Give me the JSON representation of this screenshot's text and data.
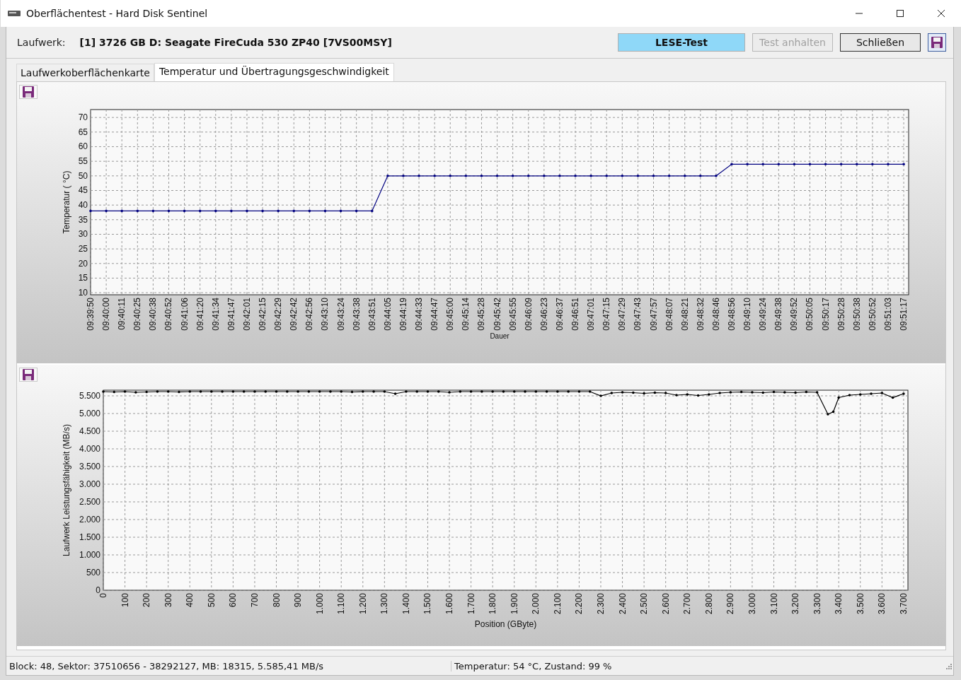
{
  "window": {
    "title": "Oberflächentest - Hard Disk Sentinel"
  },
  "toolbar": {
    "drive_label": "Laufwerk:",
    "drive_value": "[1] 3726 GB D: Seagate FireCuda 530 ZP40 [7VS00MSY]",
    "buttons": [
      {
        "label": "LESE-Test",
        "kind": "indicator",
        "disabled": false
      },
      {
        "label": "Test anhalten",
        "kind": "button",
        "disabled": true
      },
      {
        "label": "Schließen",
        "kind": "button",
        "disabled": false
      }
    ]
  },
  "tabs": [
    {
      "label": "Laufwerkoberflächenkarte",
      "selected": false
    },
    {
      "label": "Temperatur und Übertragungsgeschwindigkeit",
      "selected": true
    }
  ],
  "panels": [
    {
      "chart_data": {
        "type": "line",
        "xlabel": "Dauer",
        "ylabel": "Temperatur ( °C)",
        "categories": [
          "09:39:50",
          "09:40:00",
          "09:40:11",
          "09:40:25",
          "09:40:38",
          "09:40:52",
          "09:41:06",
          "09:41:20",
          "09:41:34",
          "09:41:47",
          "09:42:01",
          "09:42:15",
          "09:42:29",
          "09:42:42",
          "09:42:56",
          "09:43:10",
          "09:43:24",
          "09:43:38",
          "09:43:51",
          "09:44:05",
          "09:44:19",
          "09:44:33",
          "09:44:47",
          "09:45:00",
          "09:45:14",
          "09:45:28",
          "09:45:42",
          "09:45:55",
          "09:46:09",
          "09:46:23",
          "09:46:37",
          "09:46:51",
          "09:47:01",
          "09:47:15",
          "09:47:29",
          "09:47:43",
          "09:47:57",
          "09:48:07",
          "09:48:21",
          "09:48:32",
          "09:48:46",
          "09:48:56",
          "09:49:10",
          "09:49:24",
          "09:49:38",
          "09:49:52",
          "09:50:05",
          "09:50:17",
          "09:50:28",
          "09:50:38",
          "09:50:52",
          "09:51:03",
          "09:51:17"
        ],
        "grid": true,
        "series": [
          {
            "color": "#000080",
            "values": [
              38,
              38,
              38,
              38,
              38,
              38,
              38,
              38,
              38,
              38,
              38,
              38,
              38,
              38,
              38,
              38,
              38,
              38,
              38,
              50,
              50,
              50,
              50,
              50,
              50,
              50,
              50,
              50,
              50,
              50,
              50,
              50,
              50,
              50,
              50,
              50,
              50,
              50,
              50,
              50,
              50,
              54,
              54,
              54,
              54,
              54,
              54,
              54,
              54,
              54,
              54,
              54,
              54
            ]
          }
        ],
        "ylim": [
          9.3,
          72.7
        ],
        "yticks": [
          10,
          15,
          20,
          25,
          30,
          35,
          40,
          45,
          50,
          55,
          60,
          65,
          70
        ]
      }
    },
    {
      "chart_data": {
        "type": "line",
        "xlabel": "Position (GByte)",
        "ylabel": "Laufwerk Leistungsfähigkeit (MB/s)",
        "x": [
          0,
          50,
          100,
          150,
          200,
          250,
          300,
          350,
          400,
          450,
          500,
          550,
          600,
          650,
          700,
          750,
          800,
          850,
          900,
          950,
          1000,
          1050,
          1100,
          1150,
          1200,
          1250,
          1300,
          1350,
          1400,
          1450,
          1500,
          1550,
          1600,
          1650,
          1700,
          1750,
          1800,
          1850,
          1900,
          1950,
          2000,
          2050,
          2100,
          2150,
          2200,
          2250,
          2300,
          2350,
          2400,
          2450,
          2500,
          2550,
          2600,
          2650,
          2700,
          2750,
          2800,
          2850,
          2900,
          2950,
          3000,
          3050,
          3100,
          3150,
          3200,
          3250,
          3300,
          3350,
          3375,
          3400,
          3450,
          3500,
          3550,
          3600,
          3650,
          3700
        ],
        "grid": true,
        "series": [
          {
            "color": "#000000",
            "values": [
              5620,
              5610,
              5620,
              5600,
              5610,
              5620,
              5620,
              5610,
              5620,
              5620,
              5620,
              5620,
              5620,
              5620,
              5620,
              5620,
              5620,
              5620,
              5620,
              5620,
              5620,
              5620,
              5620,
              5610,
              5620,
              5620,
              5620,
              5560,
              5620,
              5620,
              5620,
              5620,
              5600,
              5620,
              5620,
              5620,
              5620,
              5620,
              5620,
              5620,
              5620,
              5620,
              5620,
              5620,
              5620,
              5620,
              5500,
              5580,
              5600,
              5590,
              5570,
              5590,
              5580,
              5520,
              5540,
              5510,
              5540,
              5580,
              5600,
              5610,
              5600,
              5590,
              5610,
              5600,
              5590,
              5610,
              5600,
              4980,
              5050,
              5450,
              5520,
              5540,
              5560,
              5580,
              5450,
              5560
            ]
          }
        ],
        "xlim": [
          0,
          3720
        ],
        "ylim": [
          0,
          5660
        ],
        "xticks": [
          {
            "value": 0,
            "label": "0"
          },
          {
            "value": 100,
            "label": "100"
          },
          {
            "value": 200,
            "label": "200"
          },
          {
            "value": 300,
            "label": "300"
          },
          {
            "value": 400,
            "label": "400"
          },
          {
            "value": 500,
            "label": "500"
          },
          {
            "value": 600,
            "label": "600"
          },
          {
            "value": 700,
            "label": "700"
          },
          {
            "value": 800,
            "label": "800"
          },
          {
            "value": 900,
            "label": "900"
          },
          {
            "value": 1000,
            "label": "1.000"
          },
          {
            "value": 1100,
            "label": "1.100"
          },
          {
            "value": 1200,
            "label": "1.200"
          },
          {
            "value": 1300,
            "label": "1.300"
          },
          {
            "value": 1400,
            "label": "1.400"
          },
          {
            "value": 1500,
            "label": "1.500"
          },
          {
            "value": 1600,
            "label": "1.600"
          },
          {
            "value": 1700,
            "label": "1.700"
          },
          {
            "value": 1800,
            "label": "1.800"
          },
          {
            "value": 1900,
            "label": "1.900"
          },
          {
            "value": 2000,
            "label": "2.000"
          },
          {
            "value": 2100,
            "label": "2.100"
          },
          {
            "value": 2200,
            "label": "2.200"
          },
          {
            "value": 2300,
            "label": "2.300"
          },
          {
            "value": 2400,
            "label": "2.400"
          },
          {
            "value": 2500,
            "label": "2.500"
          },
          {
            "value": 2600,
            "label": "2.600"
          },
          {
            "value": 2700,
            "label": "2.700"
          },
          {
            "value": 2800,
            "label": "2.800"
          },
          {
            "value": 2900,
            "label": "2.900"
          },
          {
            "value": 3000,
            "label": "3.000"
          },
          {
            "value": 3100,
            "label": "3.100"
          },
          {
            "value": 3200,
            "label": "3.200"
          },
          {
            "value": 3300,
            "label": "3.300"
          },
          {
            "value": 3400,
            "label": "3.400"
          },
          {
            "value": 3500,
            "label": "3.500"
          },
          {
            "value": 3600,
            "label": "3.600"
          },
          {
            "value": 3700,
            "label": "3.700"
          }
        ],
        "yticks": [
          {
            "value": 0,
            "label": "0"
          },
          {
            "value": 500,
            "label": "500"
          },
          {
            "value": 1000,
            "label": "1.000"
          },
          {
            "value": 1500,
            "label": "1.500"
          },
          {
            "value": 2000,
            "label": "2.000"
          },
          {
            "value": 2500,
            "label": "2.500"
          },
          {
            "value": 3000,
            "label": "3.000"
          },
          {
            "value": 3500,
            "label": "3.500"
          },
          {
            "value": 4000,
            "label": "4.000"
          },
          {
            "value": 4500,
            "label": "4.500"
          },
          {
            "value": 5000,
            "label": "5.000"
          },
          {
            "value": 5500,
            "label": "5.500"
          }
        ]
      }
    }
  ],
  "status_bar": [
    "Block: 48, Sektor: 37510656 - 38292127, MB: 18315, 5.585,41 MB/s",
    "Temperatur: 54  °C,  Zustand: 99 %"
  ]
}
